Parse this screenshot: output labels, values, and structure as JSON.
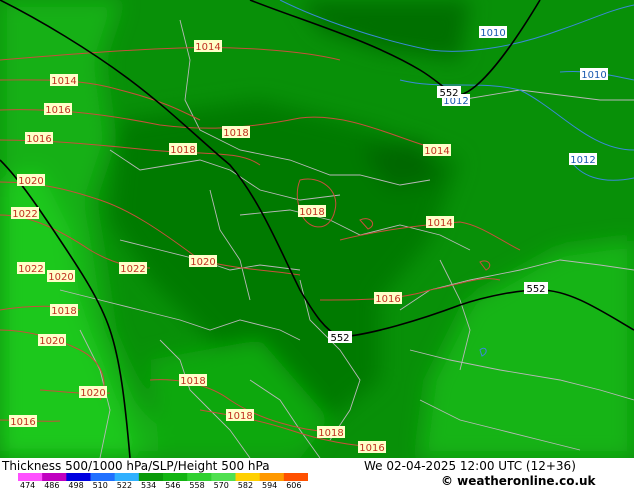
{
  "colors": {
    "land_dark": "#047a04",
    "land_mid": "#0a9a0a",
    "land_light": "#14b814",
    "land_bright": "#1ed01e",
    "isobar": "#c8503c",
    "isobar_blue": "#3a8ad8",
    "contour": "#000000",
    "border": "#b8b8b8"
  },
  "isobar_labels": [
    {
      "text": "1014",
      "style": "red"
    },
    {
      "text": "1014",
      "style": "red"
    },
    {
      "text": "1016",
      "style": "red"
    },
    {
      "text": "1018",
      "style": "red"
    },
    {
      "text": "1016",
      "style": "red"
    },
    {
      "text": "1018",
      "style": "red"
    },
    {
      "text": "1020",
      "style": "red"
    },
    {
      "text": "1014",
      "style": "red"
    },
    {
      "text": "1018",
      "style": "red"
    },
    {
      "text": "1022",
      "style": "red"
    },
    {
      "text": "1014",
      "style": "red"
    },
    {
      "text": "1022",
      "style": "red"
    },
    {
      "text": "1020",
      "style": "red"
    },
    {
      "text": "1022",
      "style": "red"
    },
    {
      "text": "1020",
      "style": "red"
    },
    {
      "text": "1018",
      "style": "red"
    },
    {
      "text": "1016",
      "style": "red"
    },
    {
      "text": "1020",
      "style": "red"
    },
    {
      "text": "1020",
      "style": "red"
    },
    {
      "text": "1018",
      "style": "red"
    },
    {
      "text": "1016",
      "style": "red"
    },
    {
      "text": "1018",
      "style": "red"
    },
    {
      "text": "1018",
      "style": "red"
    },
    {
      "text": "1016",
      "style": "red"
    },
    {
      "text": "1010",
      "style": "blue"
    },
    {
      "text": "1010",
      "style": "blue"
    },
    {
      "text": "1012",
      "style": "blue"
    },
    {
      "text": "1012",
      "style": "blue"
    }
  ],
  "contour_labels": [
    "552",
    "552",
    "552"
  ],
  "footer": {
    "title": "Thickness 500/1000 hPa/SLP/Height 500 hPa",
    "datetime": "We 02-04-2025 12:00 UTC (12+36)",
    "credit": "© weatheronline.co.uk",
    "scale_values": [
      "474",
      "486",
      "498",
      "510",
      "522",
      "534",
      "546",
      "558",
      "570",
      "582",
      "594",
      "606"
    ],
    "scale_colors": [
      "#ff50ff",
      "#c000c0",
      "#0000e0",
      "#2070ff",
      "#30b0ff",
      "#0a9a0a",
      "#12b412",
      "#30d030",
      "#50e050",
      "#ffd000",
      "#ff9900",
      "#ff5000"
    ]
  }
}
